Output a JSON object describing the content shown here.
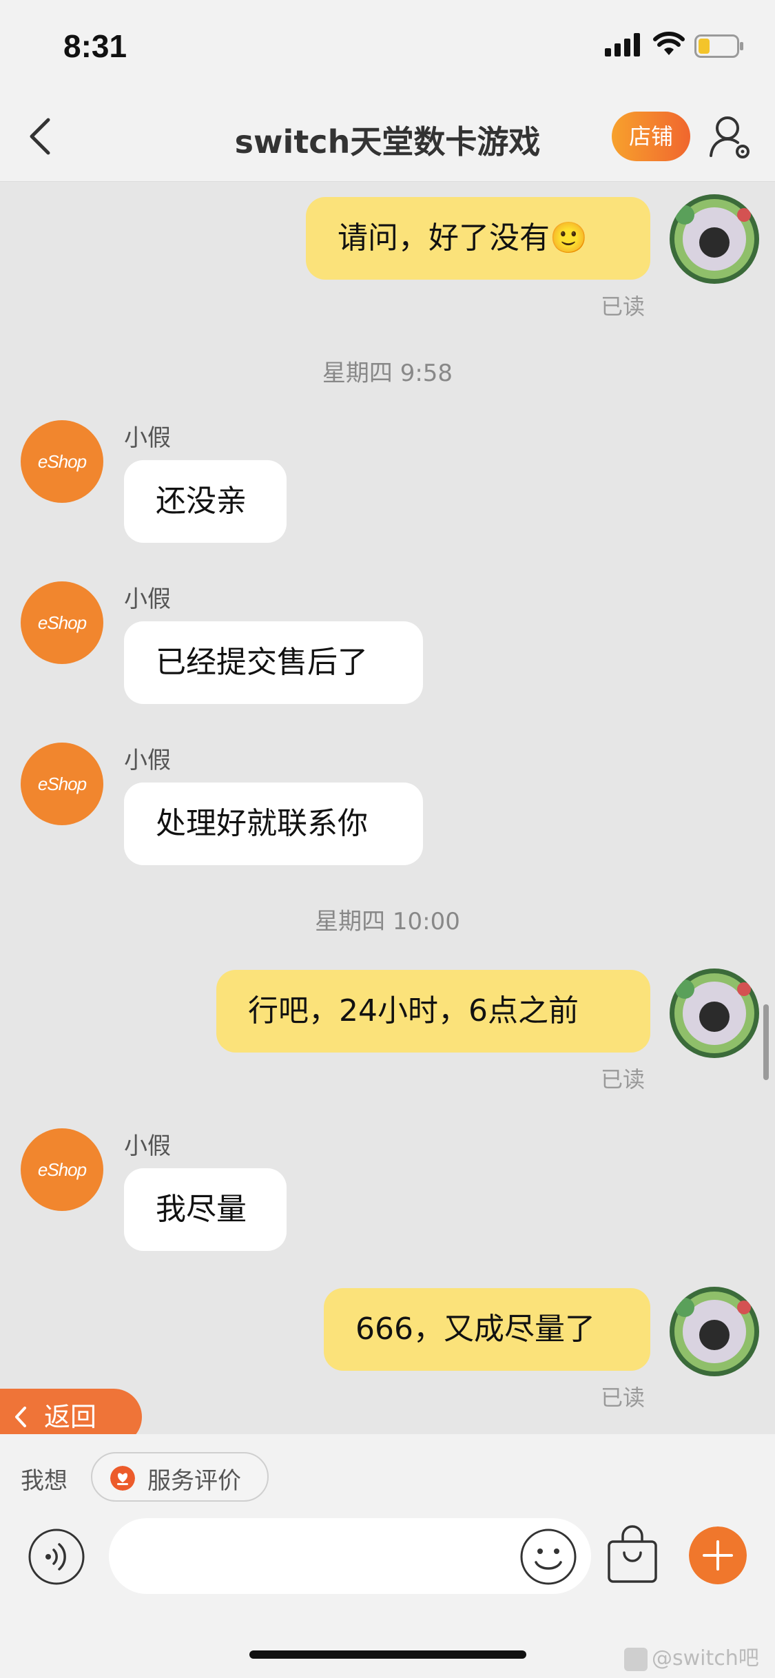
{
  "status_bar": {
    "time": "8:31"
  },
  "nav": {
    "title": "switch天堂数卡游戏",
    "shop_label": "店铺"
  },
  "messages": [
    {
      "text": "请问，好了没有🙂",
      "read": "已读"
    },
    {
      "timestamp": "星期四 9:58"
    },
    {
      "sender": "小假",
      "text": "还没亲"
    },
    {
      "sender": "小假",
      "text": "已经提交售后了"
    },
    {
      "sender": "小假",
      "text": "处理好就联系你"
    },
    {
      "timestamp": "星期四 10:00"
    },
    {
      "text": "行吧，24小时，6点之前",
      "read": "已读"
    },
    {
      "sender": "小假",
      "text": "我尽量"
    },
    {
      "text": "666，又成尽量了",
      "read": "已读"
    }
  ],
  "shop_avatar_label": "eShop",
  "return_label": "返回",
  "quick_actions": {
    "prefix": "我想",
    "service_review": "服务评价"
  },
  "input": {
    "placeholder": ""
  },
  "watermark": "@switch吧",
  "colors": {
    "accent": "#f0772c",
    "my_bubble": "#fbe27a",
    "their_bubble": "#ffffff",
    "chat_background": "#e6e6e6"
  }
}
